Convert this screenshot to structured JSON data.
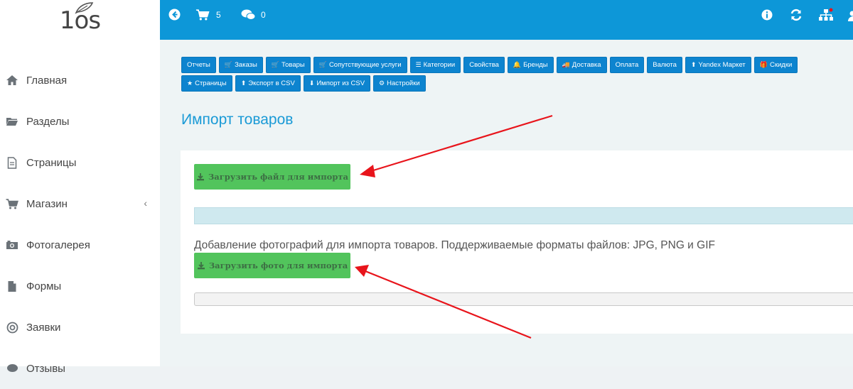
{
  "logo": {
    "text": "1os"
  },
  "topbar": {
    "cart_count": "5",
    "comments_count": "0"
  },
  "sidebar": {
    "items": [
      {
        "label": "Главная",
        "icon": "home-icon"
      },
      {
        "label": "Разделы",
        "icon": "folder-icon"
      },
      {
        "label": "Страницы",
        "icon": "file-icon"
      },
      {
        "label": "Магазин",
        "icon": "cart-icon",
        "chevron": "‹"
      },
      {
        "label": "Фотогалерея",
        "icon": "camera-icon"
      },
      {
        "label": "Формы",
        "icon": "document-icon"
      },
      {
        "label": "Заявки",
        "icon": "target-icon"
      },
      {
        "label": "Отзывы",
        "icon": "comment-icon"
      }
    ]
  },
  "toolbar": {
    "row1": [
      {
        "label": "Отчеты",
        "icon": ""
      },
      {
        "label": "Заказы",
        "icon": "🛒"
      },
      {
        "label": "Товары",
        "icon": "🛒"
      },
      {
        "label": "Сопутствующие услуги",
        "icon": "🛒"
      },
      {
        "label": "Категории",
        "icon": "☰"
      },
      {
        "label": "Свойства",
        "icon": ""
      },
      {
        "label": "Бренды",
        "icon": "🔔"
      },
      {
        "label": "Доставка",
        "icon": "🚚"
      },
      {
        "label": "Оплата",
        "icon": ""
      },
      {
        "label": "Валюта",
        "icon": ""
      },
      {
        "label": "Yandex Маркет",
        "icon": "⬆"
      },
      {
        "label": "Скидки",
        "icon": "🎁"
      }
    ],
    "row2": [
      {
        "label": "Страницы",
        "icon": "★"
      },
      {
        "label": "Экспорт в CSV",
        "icon": "⬆"
      },
      {
        "label": "Импорт из CSV",
        "icon": "⬇"
      },
      {
        "label": "Настройки",
        "icon": "⚙"
      }
    ]
  },
  "main": {
    "title": "Импорт товаров",
    "upload_file_label": "Загрузить файл для импорта",
    "photos_info": "Добавление фотографий для импорта товаров. Поддерживаемые форматы файлов: JPG, PNG и GIF",
    "upload_photo_label": "Загрузить фото для импорта"
  },
  "colors": {
    "topbar": "#0d97d8",
    "button": "#0d84cf",
    "green": "#52c45c",
    "arrow": "#e8141b"
  }
}
